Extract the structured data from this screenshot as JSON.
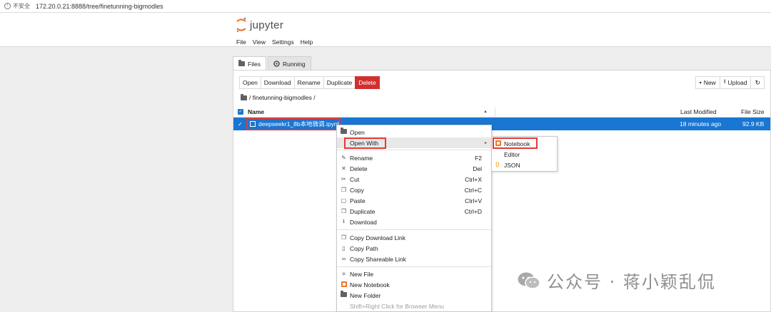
{
  "browser": {
    "security_label": "不安全",
    "url": "172.20.0.21:8888/tree/finetunning-bigmodles"
  },
  "app": {
    "logo_text": "jupyter",
    "menu": [
      "File",
      "View",
      "Settings",
      "Help"
    ]
  },
  "tabs": [
    {
      "label": "Files",
      "active": true
    },
    {
      "label": "Running",
      "active": false
    }
  ],
  "toolbar": {
    "buttons": [
      "Open",
      "Download",
      "Rename",
      "Duplicate",
      "Delete"
    ],
    "new_label": "New",
    "upload_label": "Upload"
  },
  "breadcrumb": "/ finetunning-bigmodles /",
  "file_list": {
    "columns": {
      "name": "Name",
      "modified": "Last Modified",
      "size": "File Size"
    },
    "rows": [
      {
        "name": "deepseekr1_8b本地微调.ipynb",
        "modified": "18 minutes ago",
        "size": "92.9 KB",
        "selected": true
      }
    ]
  },
  "context_menu": {
    "items": [
      {
        "label": "Open",
        "icon": "folder-icon"
      },
      {
        "label": "Open With",
        "icon": "",
        "has_submenu": true
      },
      {
        "label": "Rename",
        "icon": "pencil-icon",
        "shortcut": "F2"
      },
      {
        "label": "Delete",
        "icon": "close-icon",
        "shortcut": "Del"
      },
      {
        "label": "Cut",
        "icon": "scissors-icon",
        "shortcut": "Ctrl+X"
      },
      {
        "label": "Copy",
        "icon": "copy-icon",
        "shortcut": "Ctrl+C"
      },
      {
        "label": "Paste",
        "icon": "paste-icon",
        "shortcut": "Ctrl+V"
      },
      {
        "label": "Duplicate",
        "icon": "duplicate-icon",
        "shortcut": "Ctrl+D"
      },
      {
        "label": "Download",
        "icon": "download-icon"
      },
      {
        "label": "Copy Download Link",
        "icon": "copy-icon"
      },
      {
        "label": "Copy Path",
        "icon": "file-icon"
      },
      {
        "label": "Copy Shareable Link",
        "icon": "link-icon"
      },
      {
        "label": "New File",
        "icon": "new-file-icon"
      },
      {
        "label": "New Notebook",
        "icon": "notebook-icon"
      },
      {
        "label": "New Folder",
        "icon": "folder-icon"
      },
      {
        "label": "Shift+Right Click for Browser Menu",
        "icon": "",
        "disabled": true
      }
    ]
  },
  "submenu": {
    "items": [
      {
        "label": "Notebook",
        "icon": "notebook-icon"
      },
      {
        "label": "Editor",
        "icon": ""
      },
      {
        "label": "JSON",
        "icon": "json-icon"
      }
    ]
  },
  "watermark": {
    "text": "公众号 · 蒋小颖乱侃"
  },
  "colors": {
    "selection_blue": "#1976d2",
    "delete_red": "#d32f2f",
    "highlight_red": "#e53935",
    "jupyter_orange": "#f37626"
  }
}
